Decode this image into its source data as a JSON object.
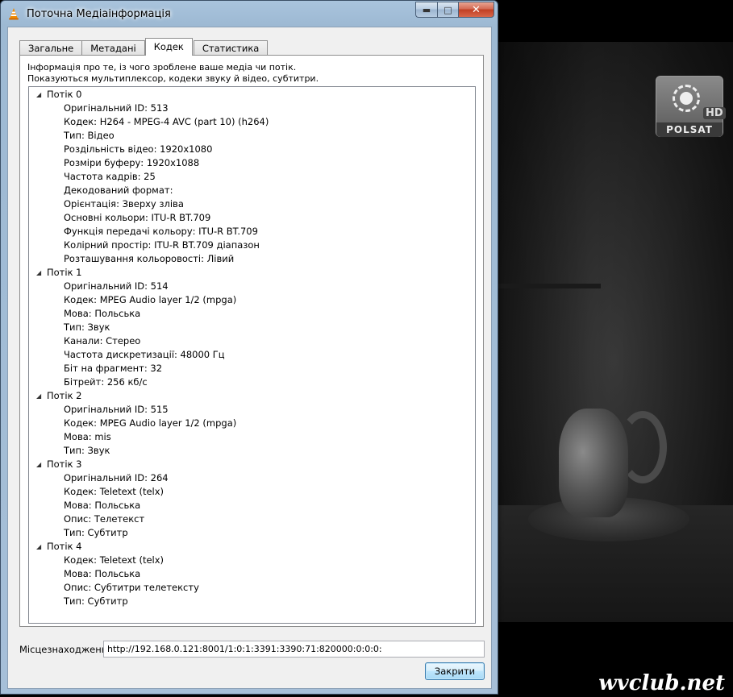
{
  "window": {
    "title": "Поточна Медіаінформація",
    "icon": "vlc-cone-icon"
  },
  "tabs": [
    {
      "label": "Загальне",
      "active": false
    },
    {
      "label": "Метадані",
      "active": false
    },
    {
      "label": "Кодек",
      "active": true
    },
    {
      "label": "Статистика",
      "active": false
    }
  ],
  "description": {
    "line1": "Інформація про те, із чого зроблене ваше медіа чи потік.",
    "line2": "Показуються мультиплексор, кодеки звуку й відео, субтитри."
  },
  "streams": [
    {
      "label": "Потік 0",
      "props": [
        "Оригінальний ID: 513",
        "Кодек: H264 - MPEG-4 AVC (part 10) (h264)",
        "Тип: Відео",
        "Роздільність відео: 1920x1080",
        "Розміри буферу: 1920x1088",
        "Частота кадрів: 25",
        "Декодований формат:",
        "Орієнтація: Зверху зліва",
        "Основні кольори: ITU-R BT.709",
        "Функція передачі кольору: ITU-R BT.709",
        "Колірний простір: ITU-R BT.709 діапазон",
        "Розташування кольоровості: Лівий"
      ]
    },
    {
      "label": "Потік 1",
      "props": [
        "Оригінальний ID: 514",
        "Кодек: MPEG Audio layer 1/2 (mpga)",
        "Мова: Польська",
        "Тип: Звук",
        "Канали: Стерео",
        "Частота дискретизації: 48000 Гц",
        "Біт на фрагмент: 32",
        "Бітрейт: 256 кб/с"
      ]
    },
    {
      "label": "Потік 2",
      "props": [
        "Оригінальний ID: 515",
        "Кодек: MPEG Audio layer 1/2 (mpga)",
        "Мова: mis",
        "Тип: Звук"
      ]
    },
    {
      "label": "Потік 3",
      "props": [
        "Оригінальний ID: 264",
        "Кодек: Teletext (telx)",
        "Мова: Польська",
        "Опис: Телетекст",
        "Тип: Субтитр"
      ]
    },
    {
      "label": "Потік 4",
      "props": [
        "Кодек: Teletext (telx)",
        "Мова: Польська",
        "Опис: Субтитри телетексту",
        "Тип: Субтитр"
      ]
    }
  ],
  "location": {
    "label": "Місцезнаходження:",
    "value": "http://192.168.0.121:8001/1:0:1:3391:3390:71:820000:0:0:0:"
  },
  "buttons": {
    "close": "Закрити"
  },
  "video": {
    "channel_name": "POLSAT",
    "channel_badge": "HD",
    "watermark": "wvclub.net"
  }
}
